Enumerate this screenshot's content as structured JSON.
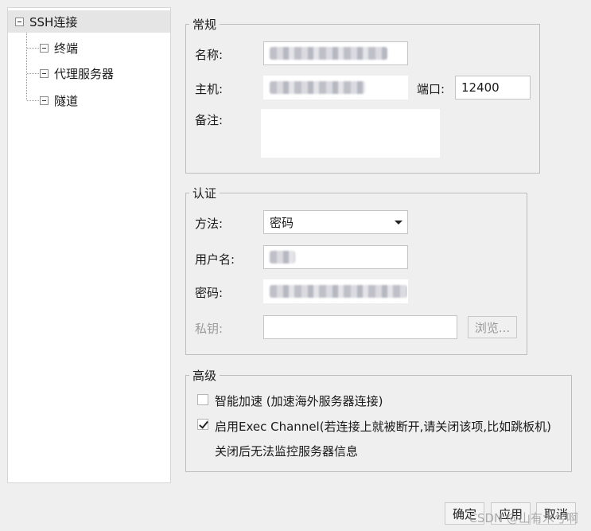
{
  "tree": {
    "root_label": "SSH连接",
    "children": [
      "终端",
      "代理服务器",
      "隧道"
    ]
  },
  "general": {
    "legend": "常规",
    "name_label": "名称:",
    "host_label": "主机:",
    "port_label": "端口:",
    "port_value": "12400",
    "note_label": "备注:"
  },
  "auth": {
    "legend": "认证",
    "method_label": "方法:",
    "method_value": "密码",
    "username_label": "用户名:",
    "password_label": "密码:",
    "key_label": "私钥:",
    "browse_label": "浏览..."
  },
  "advanced": {
    "legend": "高级",
    "smart_accel_label": "智能加速 (加速海外服务器连接)",
    "smart_accel_checked": false,
    "exec_channel_label": "启用Exec Channel(若连接上就被断开,请关闭该项,比如跳板机)",
    "exec_channel_checked": true,
    "exec_channel_note": "关闭后无法监控服务器信息"
  },
  "footer": {
    "ok_label": "确定",
    "apply_label": "应用",
    "cancel_label": "取消",
    "watermark": "CSDN @山有木兮啊"
  }
}
